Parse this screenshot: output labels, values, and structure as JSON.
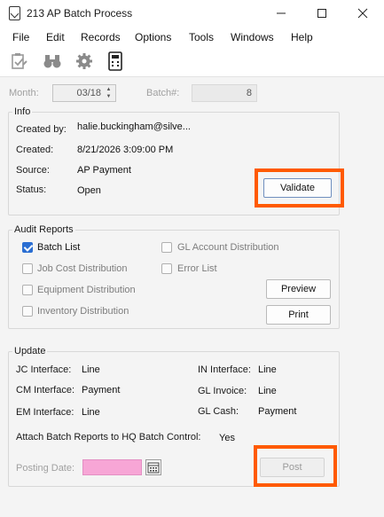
{
  "window": {
    "title": "213 AP Batch Process",
    "controls": [
      "minimize",
      "maximize",
      "close"
    ]
  },
  "menu": [
    "File",
    "Edit",
    "Records",
    "Options",
    "Tools",
    "Windows",
    "Help"
  ],
  "toolbar": {
    "icons": [
      "clipboard-check-icon",
      "binoculars-icon",
      "gear-icon",
      "calculator-icon"
    ]
  },
  "header": {
    "month_label": "Month:",
    "month_value": "03/18",
    "batch_label": "Batch#:",
    "batch_value": "8"
  },
  "info": {
    "title": "Info",
    "created_by_label": "Created by:",
    "created_by_value": "halie.buckingham@silve...",
    "created_label": "Created:",
    "created_value": "8/21/2026 3:09:00 PM",
    "source_label": "Source:",
    "source_value": "AP Payment",
    "status_label": "Status:",
    "status_value": "Open",
    "validate_label": "Validate"
  },
  "audit": {
    "title": "Audit Reports",
    "items": [
      {
        "label": "Batch List",
        "checked": true
      },
      {
        "label": "Job Cost Distribution",
        "checked": false
      },
      {
        "label": "Equipment Distribution",
        "checked": false
      },
      {
        "label": "Inventory Distribution",
        "checked": false
      },
      {
        "label": "GL Account Distribution",
        "checked": false
      },
      {
        "label": "Error List",
        "checked": false
      }
    ],
    "preview_label": "Preview",
    "print_label": "Print"
  },
  "update": {
    "title": "Update",
    "jc_label": "JC Interface:",
    "jc_value": "Line",
    "cm_label": "CM Interface:",
    "cm_value": "Payment",
    "em_label": "EM Interface:",
    "em_value": "Line",
    "in_label": "IN Interface:",
    "in_value": "Line",
    "gl_invoice_label": "GL Invoice:",
    "gl_invoice_value": "Line",
    "gl_cash_label": "GL Cash:",
    "gl_cash_value": "Payment",
    "attach_label": "Attach Batch Reports to HQ Batch Control:",
    "attach_value": "Yes",
    "posting_date_label": "Posting Date:",
    "posting_date_value": "",
    "post_label": "Post"
  },
  "colors": {
    "highlight": "#ff5a00",
    "posting_date_required": "#f7a6d6",
    "checkbox_checked": "#2a6ed2"
  }
}
